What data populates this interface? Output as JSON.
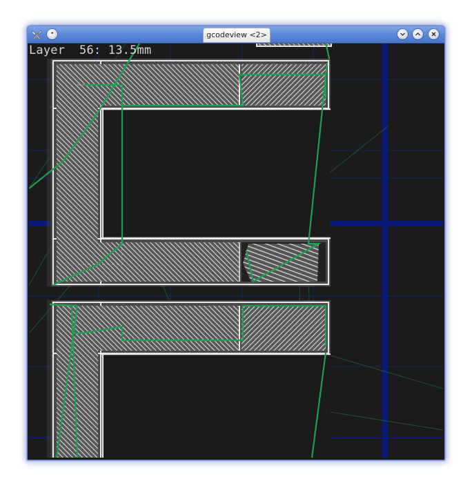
{
  "window": {
    "title": "gcodeview <2>",
    "icons": {
      "app": "tools-icon",
      "menu": "window-menu-icon",
      "minimize": "minimize-icon",
      "maximize": "maximize-icon",
      "close": "close-icon"
    },
    "accent": "#5b86d6"
  },
  "viewer": {
    "layer_label": "Layer  56: 13.5mm",
    "colors": {
      "background": "#1b1b1b",
      "grid_major": "#0a1a6e",
      "grid_minor": "#0c2046",
      "infill": "#d8d8d8",
      "travel": "#1fa050",
      "travel_faded": "#1c6b44"
    }
  }
}
